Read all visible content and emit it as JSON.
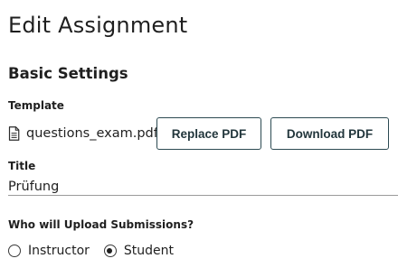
{
  "page": {
    "title": "Edit Assignment"
  },
  "basic_settings": {
    "heading": "Basic Settings",
    "template": {
      "label": "Template",
      "file_name": "questions_exam.pdf",
      "file_icon": "file-icon",
      "replace_button": "Replace PDF",
      "download_button": "Download PDF"
    },
    "title_field": {
      "label": "Title",
      "value": "Prüfung"
    },
    "uploader": {
      "label": "Who will Upload Submissions?",
      "options": [
        {
          "label": "Instructor",
          "selected": false
        },
        {
          "label": "Student",
          "selected": true
        }
      ]
    }
  },
  "colors": {
    "button_border": "#2c4a52",
    "text": "#1f1f1f",
    "input_underline": "#9a9a9a"
  }
}
